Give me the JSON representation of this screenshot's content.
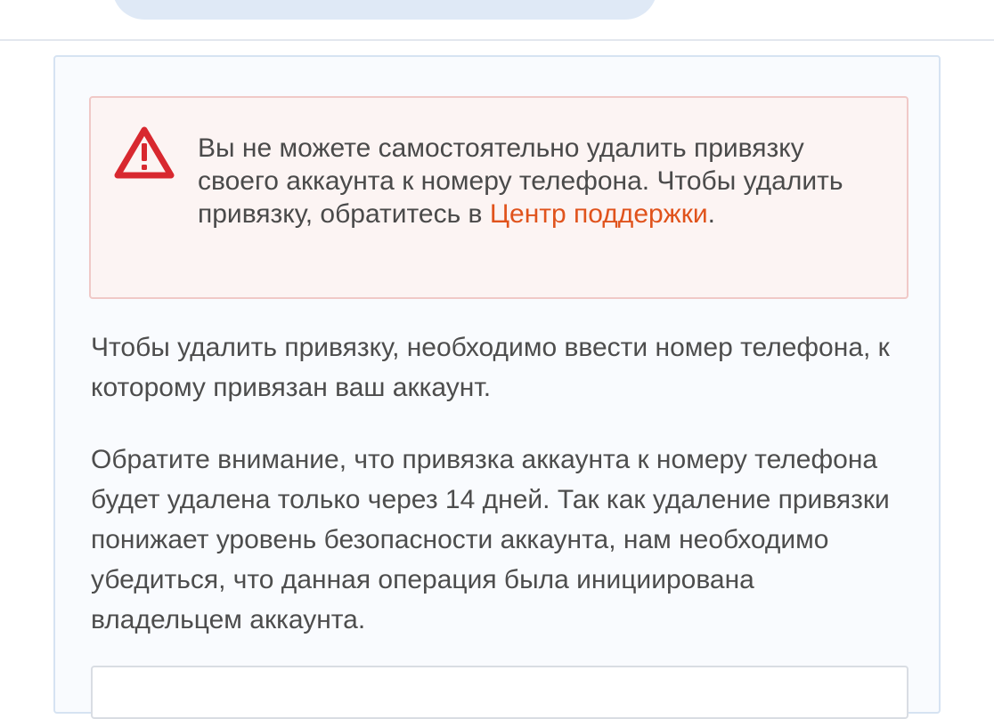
{
  "alert": {
    "icon": "warning-triangle-icon",
    "text_before_link": "Вы не можете самостоятельно удалить привязку своего аккаунта к номеру телефона. Чтобы удалить привязку, обратитесь в ",
    "link_label": "Центр поддержки",
    "text_after_link": "."
  },
  "info": {
    "paragraph_1": "Чтобы удалить привязку, необходимо ввести номер телефона, к которому привязан ваш аккаунт.",
    "paragraph_2": "Обратите внимание, что привязка аккаунта к номеру телефона будет удалена только через 14 дней. Так как удаление привязки понижает уровень безопасности аккаунта, нам необходимо убедиться, что данная операция была инициирована владельцем аккаунта."
  },
  "colors": {
    "link": "#e0531c",
    "warning_icon": "#d8282f",
    "alert_background": "#fcf4f3",
    "alert_border": "#f0c9c7",
    "text": "#4d4d4d"
  }
}
